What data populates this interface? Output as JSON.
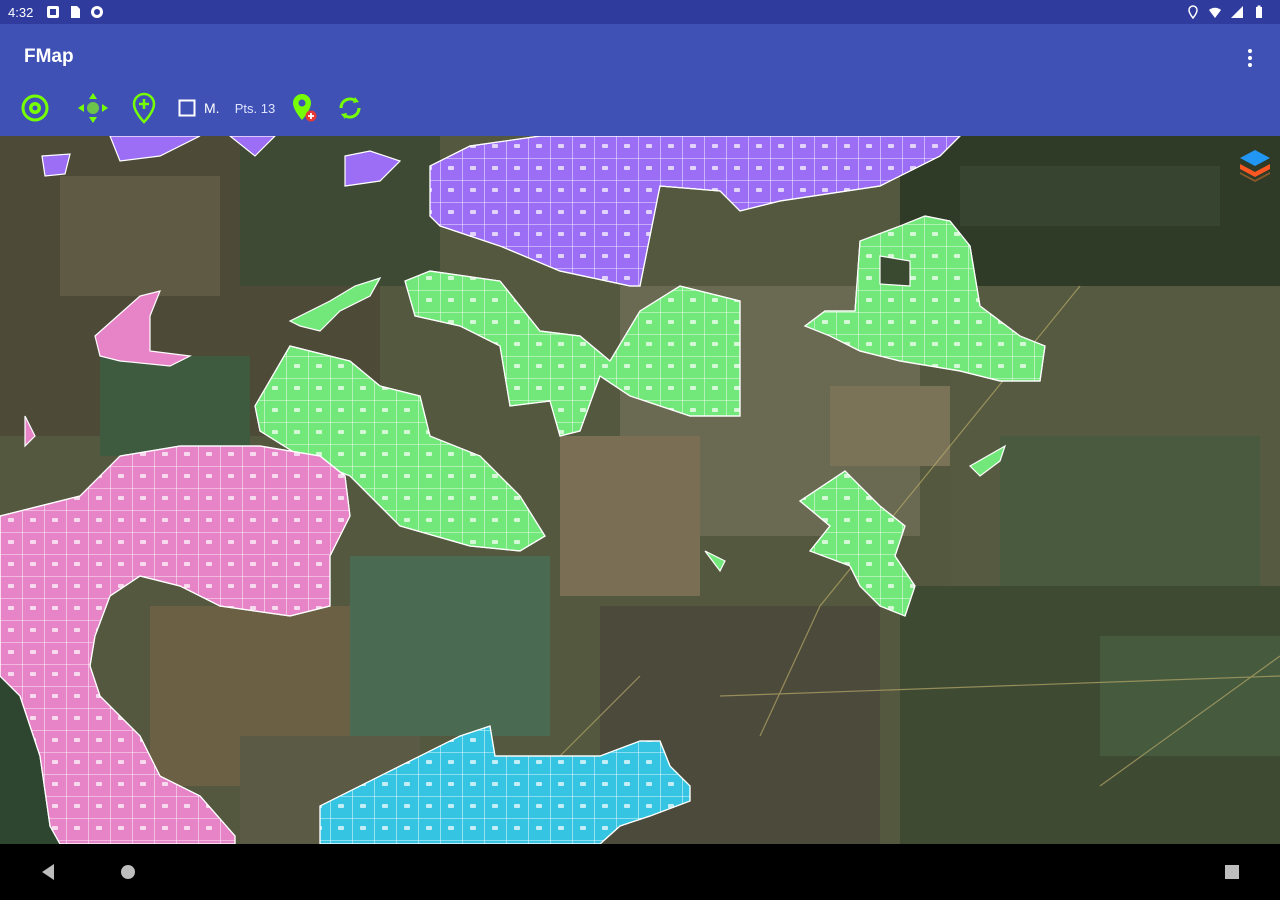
{
  "status": {
    "time": "4:32",
    "left_icons": [
      "notification-icon",
      "sd-card-icon",
      "app-icon"
    ],
    "right_icons": [
      "location-icon",
      "wifi-icon",
      "signal-icon",
      "battery-icon"
    ]
  },
  "app": {
    "title": "FMap",
    "menu_icon": "more-vert-icon"
  },
  "toolbar": {
    "gps_icon": "gps-target-icon",
    "move_icon": "move-arrows-icon",
    "add_point_icon": "add-location-icon",
    "mode_label": "M.",
    "points_label": "Pts. 13",
    "add_location_red_icon": "location-add-red-icon",
    "sync_icon": "sync-icon",
    "colors": {
      "accent": "#76ff03"
    }
  },
  "map": {
    "type": "satellite",
    "layer_button_icon": "layers-icon",
    "field_colors": {
      "purple": "#9c6df5",
      "green": "#73e87a",
      "pink": "#e784c7",
      "cyan": "#35c5e3"
    }
  },
  "navbar": {
    "back_icon": "back-triangle-icon",
    "home_icon": "home-circle-icon",
    "recents_icon": "recents-square-icon"
  }
}
